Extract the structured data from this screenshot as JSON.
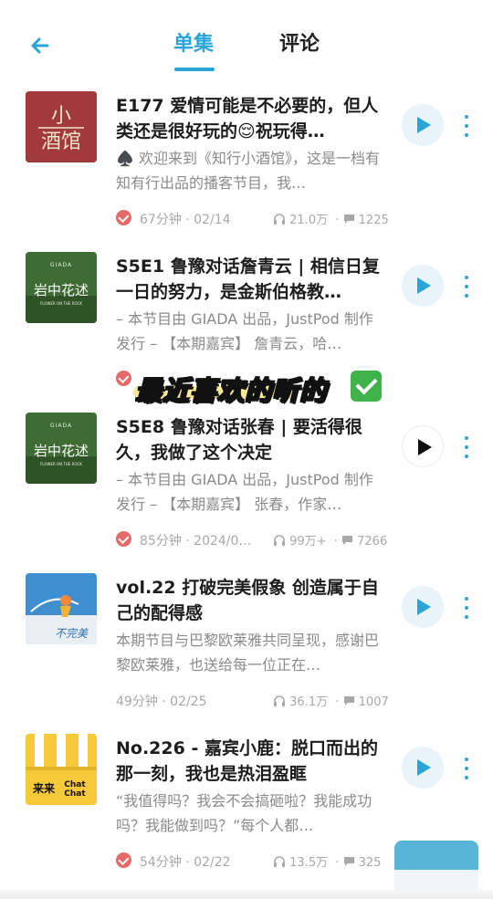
{
  "header": {
    "tabs": [
      {
        "label": "单集",
        "active": true
      },
      {
        "label": "评论",
        "active": false
      }
    ],
    "accent_color": "#2aa5d6"
  },
  "episodes": [
    {
      "title": "E177 爱情可能是不必要的，但人类还是很好玩的😌祝玩得…",
      "desc": "♠️ 欢迎来到《知行小酒馆》，这是一档有知有行出品的播客节目，我…",
      "played": true,
      "duration_date": "67分钟 · 02/14",
      "plays": "21.0万",
      "comments": "1225",
      "cover": {
        "kind": "xiaojiuguan",
        "text_top": "小",
        "text_bottom": "酒馆"
      },
      "play_style": "tinted"
    },
    {
      "title": "S5E1 鲁豫对话詹青云 | 相信日复一日的努力，是金斯伯格教…",
      "desc": "– 本节目由 GIADA 出品，JustPod 制作发行 – 【本期嘉宾】 詹青云，哈…",
      "played": true,
      "duration_date": "",
      "plays": "",
      "comments": "",
      "cover": {
        "kind": "giada",
        "brand": "GIADA",
        "name": "岩中花述",
        "sub": "FLOWER ON THE ROCK"
      },
      "play_style": "tinted"
    },
    {
      "title": "S5E8 鲁豫对话张春 | 要活得很久，我做了这个决定",
      "desc": "– 本节目由 GIADA 出品，JustPod 制作发行 – 【本期嘉宾】 张春，作家…",
      "played": true,
      "duration_date": "85分钟 · 2024/0…",
      "plays": "99万+",
      "comments": "7266",
      "cover": {
        "kind": "giada",
        "brand": "GIADA",
        "name": "岩中花述",
        "sub": "FLOWER ON THE ROCK"
      },
      "play_style": "plain"
    },
    {
      "title": "vol.22 打破完美假象 创造属于自己的配得感",
      "desc": "本期节目与巴黎欧莱雅共同呈现，感谢巴黎欧莱雅，也送给每一位正在…",
      "played": false,
      "duration_date": "49分钟 · 02/25",
      "plays": "36.1万",
      "comments": "1007",
      "cover": {
        "kind": "blue",
        "text": "不完美"
      },
      "play_style": "tinted"
    },
    {
      "title": "No.226 - 嘉宾小鹿：脱口而出的那一刻，我也是热泪盈眶",
      "desc": "“我值得吗？我会不会搞砸啦？我能成功吗？我能做到吗？”每个人都…",
      "played": true,
      "duration_date": "54分钟 · 02/22",
      "plays": "13.5万",
      "comments": "325",
      "cover": {
        "kind": "chatchat",
        "cn": "来来",
        "en1": "Chat",
        "en2": "Chat"
      },
      "play_style": "tinted"
    }
  ],
  "sticker": {
    "text": "最近喜欢的听的"
  }
}
